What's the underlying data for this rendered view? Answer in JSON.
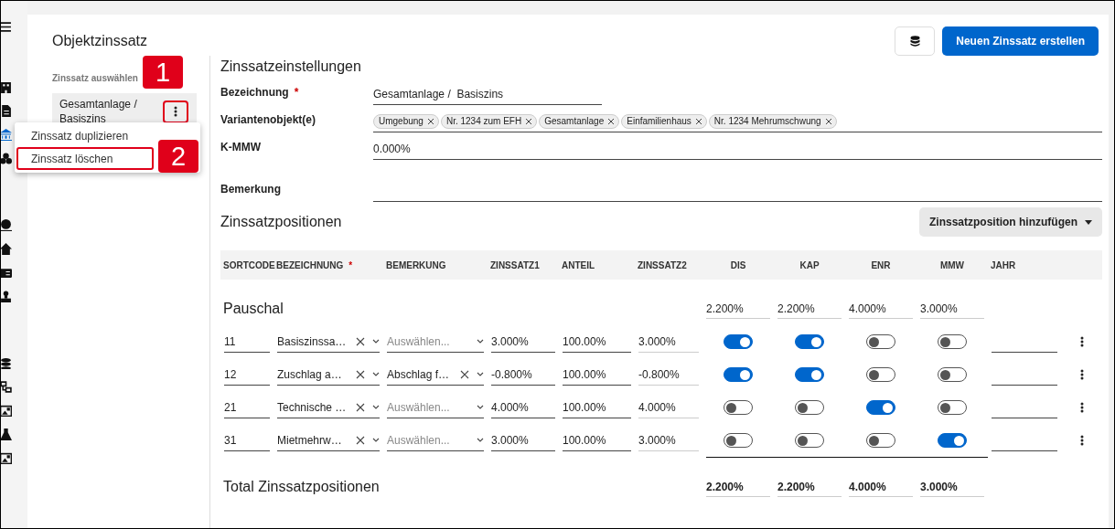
{
  "page": {
    "title": "Objektzinssatz",
    "primary_button": "Neuen Zinssatz erstellen"
  },
  "selector": {
    "label": "Zinssatz auswählen",
    "items": [
      {
        "label": "Gesamtanlage / Basiszins",
        "selected": true,
        "callout": "1"
      }
    ]
  },
  "context_menu": {
    "items": [
      {
        "label": "Zinssatz duplizieren"
      },
      {
        "label": "Zinssatz löschen",
        "callout": "2"
      }
    ]
  },
  "settings": {
    "title": "Zinssatzeinstellungen",
    "fields": [
      {
        "kind": "text",
        "label": "Bezeichnung",
        "required_mark": "*",
        "value": "Gesamtanlage /  Basiszins"
      },
      {
        "kind": "chips",
        "label": "Variantenobjekt(e)",
        "chips": [
          "Umgebung",
          "Nr. 1234 zum EFH",
          "Gesamtanlage",
          "Einfamilienhaus",
          "Nr. 1234 Mehrumschwung"
        ]
      },
      {
        "kind": "text",
        "label": "K-MMW",
        "value": "0.000%"
      },
      {
        "kind": "textarea",
        "label": "Bemerkung"
      }
    ]
  },
  "positions": {
    "title": "Zinssatzpositionen",
    "add_button": "Zinssatzposition hinzufügen",
    "columns": [
      {
        "label": "SORTCODE"
      },
      {
        "label": "BEZEICHNUNG",
        "required_mark": "*"
      },
      {
        "label": "BEMERKUNG"
      },
      {
        "label": "ZINSSATZ1"
      },
      {
        "label": "ANTEIL"
      },
      {
        "label": "ZINSSATZ2"
      },
      {
        "label": "DIS"
      },
      {
        "label": "KAP"
      },
      {
        "label": "ENR"
      },
      {
        "label": "MMW"
      },
      {
        "label": "JAHR"
      }
    ],
    "groups": [
      {
        "name": "Pauschal",
        "sums": [
          "2.200%",
          "2.200%",
          "4.000%",
          "3.000%"
        ],
        "rows": [
          {
            "sortcode": "11",
            "bezeichnung": "Basiszinssa…",
            "bemerkung": {
              "placeholder": "Auswählen..."
            },
            "zinssatz1": "3.000%",
            "anteil": "100.00%",
            "zinssatz2": "3.000%",
            "switches": [
              true,
              true,
              false,
              false
            ]
          },
          {
            "sortcode": "12",
            "bezeichnung": "Zuschlag a…",
            "bemerkung": {
              "value": "Abschlag f…"
            },
            "zinssatz1": "-0.800%",
            "anteil": "100.00%",
            "zinssatz2": "-0.800%",
            "switches": [
              true,
              true,
              false,
              false
            ]
          },
          {
            "sortcode": "21",
            "bezeichnung": "Technische …",
            "bemerkung": {
              "placeholder": "Auswählen..."
            },
            "zinssatz1": "4.000%",
            "anteil": "100.00%",
            "zinssatz2": "4.000%",
            "switches": [
              false,
              false,
              true,
              false
            ]
          },
          {
            "sortcode": "31",
            "bezeichnung": "Mietmehrw…",
            "bemerkung": {
              "placeholder": "Auswählen..."
            },
            "zinssatz1": "3.000%",
            "anteil": "100.00%",
            "zinssatz2": "3.000%",
            "switches": [
              false,
              false,
              false,
              true
            ]
          }
        ]
      }
    ],
    "total": {
      "label": "Total Zinssatzpositionen",
      "values": [
        "2.200%",
        "2.200%",
        "4.000%",
        "3.000%"
      ]
    }
  }
}
